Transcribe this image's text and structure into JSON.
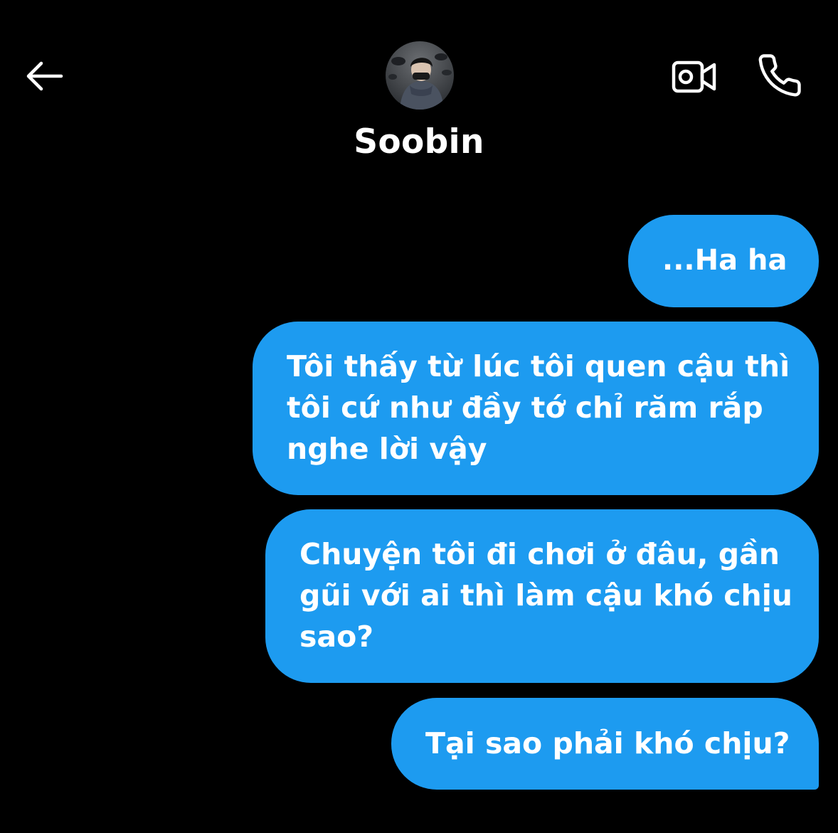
{
  "header": {
    "contact_name": "Soobin",
    "back_icon": "arrow-left-icon",
    "video_icon": "video-camera-icon",
    "call_icon": "phone-icon"
  },
  "colors": {
    "background": "#000000",
    "bubble_sent": "#1d9bf0",
    "text": "#ffffff"
  },
  "messages": [
    {
      "direction": "sent",
      "text": "...Ha ha"
    },
    {
      "direction": "sent",
      "text": "Tôi thấy từ lúc tôi quen cậu thì tôi cứ như đầy tớ chỉ răm rắp nghe lời vậy"
    },
    {
      "direction": "sent",
      "text": "Chuyện tôi đi chơi ở đâu, gần gũi với ai thì làm cậu khó chịu sao?"
    },
    {
      "direction": "sent",
      "text": "Tại sao phải khó chịu?"
    }
  ]
}
